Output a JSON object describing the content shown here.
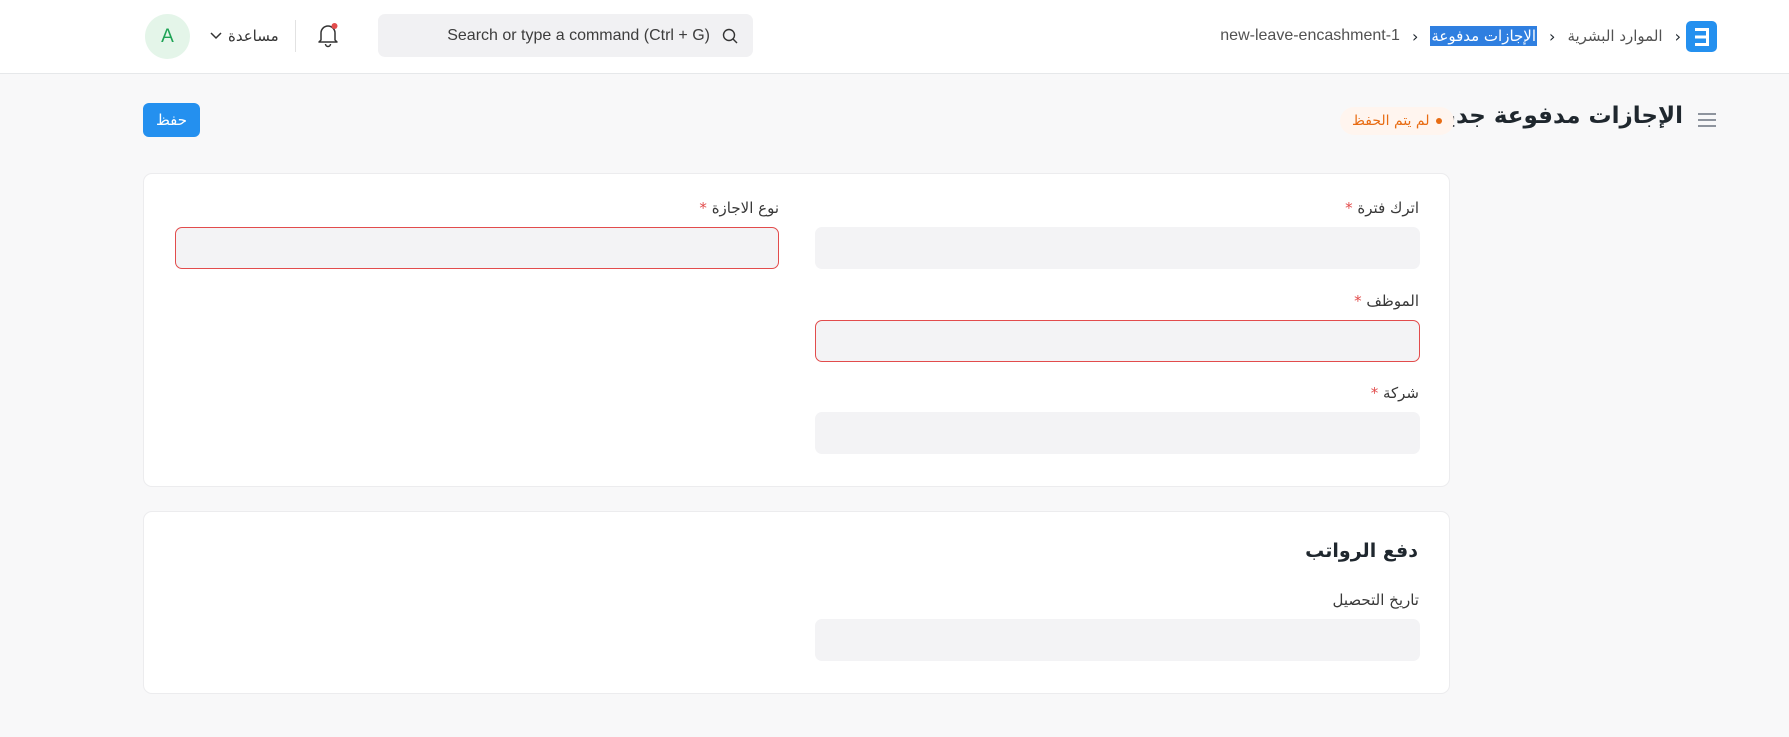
{
  "navbar": {
    "breadcrumbs": [
      "الموارد البشرية",
      "الإجازات مدفوعة",
      "new-leave-encashment-1"
    ],
    "search_placeholder": "Search or type a command (Ctrl + G)",
    "help_label": "مساعدة",
    "avatar_initial": "A"
  },
  "page": {
    "title": "الإجازات مدفوعة جديد",
    "status": "لم يتم الحفظ",
    "save_label": "حفظ"
  },
  "form": {
    "leave_period_label": "اترك فترة",
    "leave_type_label": "نوع الاجازة",
    "employee_label": "الموظف",
    "company_label": "شركة",
    "required_mark": "*",
    "payroll_section_title": "دفع الرواتب",
    "encashment_date_label": "تاريخ التحصيل"
  },
  "colors": {
    "accent": "#2490ef",
    "error": "#e24c4c",
    "status": "#e86c13"
  }
}
